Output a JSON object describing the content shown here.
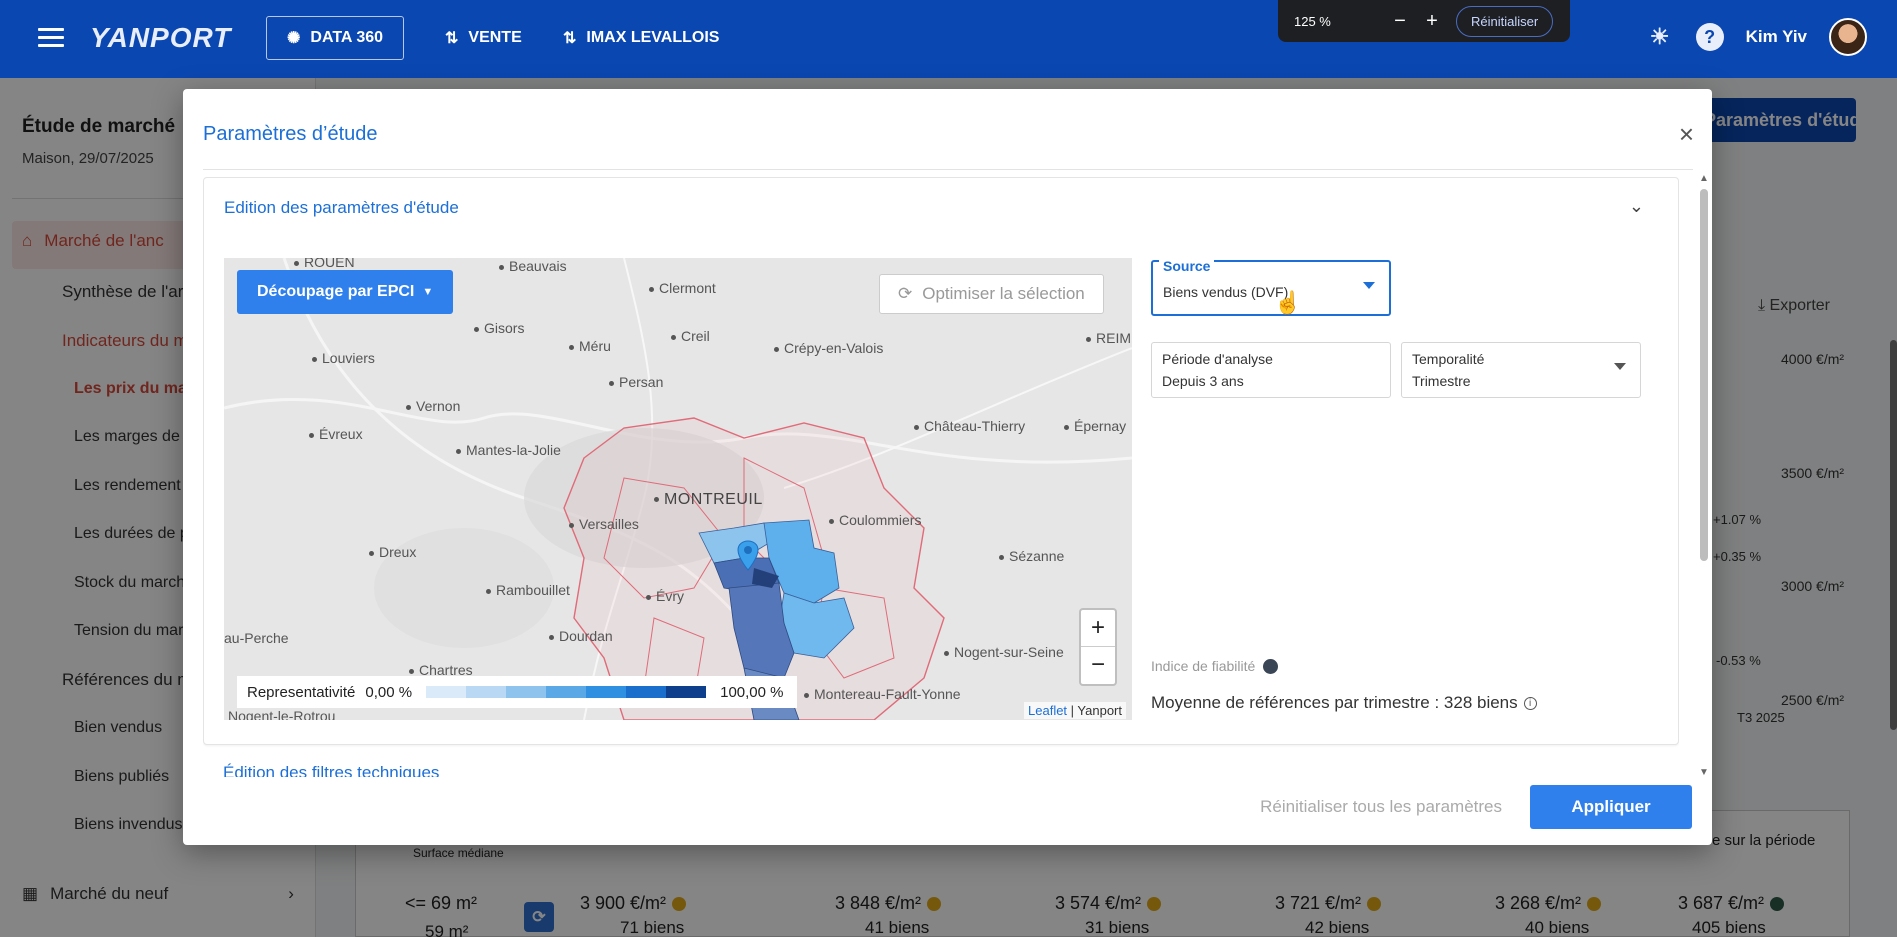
{
  "topbar": {
    "logo": "YANPORT",
    "nav": [
      {
        "label": "DATA 360"
      },
      {
        "label": "VENTE"
      },
      {
        "label": "IMAX LEVALLOIS"
      }
    ],
    "zoom": {
      "level": "125 %",
      "minus": "−",
      "plus": "+",
      "reset": "Réinitialiser"
    },
    "help": "?",
    "user_name": "Kim Yiv"
  },
  "sidebar": {
    "title": "Étude de marché",
    "subtitle": "Maison, 29/07/2025",
    "items": [
      {
        "label": "Marché de l'anc"
      },
      {
        "label": "Synthèse de l'ar"
      },
      {
        "label": "Indicateurs du m"
      },
      {
        "label": "Les prix du mar"
      },
      {
        "label": "Les marges de"
      },
      {
        "label": "Les rendement"
      },
      {
        "label": "Les durées de p"
      },
      {
        "label": "Stock du march"
      },
      {
        "label": "Tension du mar"
      },
      {
        "label": "Références du m"
      },
      {
        "label": "Bien vendus"
      },
      {
        "label": "Biens publiés"
      },
      {
        "label": "Biens invendus"
      },
      {
        "label": "Marché du neuf"
      }
    ]
  },
  "background": {
    "primary_button": "Paramètres d'étude",
    "export": "Exporter",
    "y_axis": [
      "4000 €/m²",
      "3500 €/m²",
      "3000 €/m²",
      "2500 €/m²"
    ],
    "pct_labels": [
      "+1.07 %",
      "+0.35 %",
      "-0.53 %"
    ],
    "x_label": "T3 2025",
    "table": {
      "col_surface": "Surface médiane",
      "col_periode": "e sur la période",
      "surface_value": "<= 69 m²",
      "surface_sub": "59 m²",
      "cells": [
        {
          "price": "3 900 €/m²",
          "count": "71 biens"
        },
        {
          "price": "3 848 €/m²",
          "count": "41 biens"
        },
        {
          "price": "3 574 €/m²",
          "count": "31 biens"
        },
        {
          "price": "3 721 €/m²",
          "count": "42 biens"
        },
        {
          "price": "3 268 €/m²",
          "count": "40 biens"
        },
        {
          "price": "3 687 €/m²",
          "count": "405 biens"
        }
      ]
    }
  },
  "modal": {
    "title": "Paramètres d’étude",
    "close": "×",
    "section_title": "Edition des paramètres d'étude",
    "next_section": "Édition des filtres techniques",
    "map": {
      "decoupage": "Découpage par EPCI",
      "optimiser": "Optimiser la sélection",
      "zoom_in": "+",
      "zoom_out": "−",
      "legend_label": "Representativité",
      "legend_min": "0,00 %",
      "legend_max": "100,00 %",
      "legend_colors": [
        "#dbeaf9",
        "#b9d8f3",
        "#8ec3ee",
        "#5aa8e6",
        "#2f8fe0",
        "#1a6fcc",
        "#0d3f8c"
      ],
      "attribution_link": "Leaflet",
      "attribution_text": " | Yanport",
      "cities": [
        "ROUEN",
        "Beauvais",
        "Clermont",
        "Gisors",
        "Creil",
        "Méru",
        "Crépy-en-Valois",
        "REIM",
        "Louviers",
        "Persan",
        "Vernon",
        "Évreux",
        "Mantes-la-Jolie",
        "Château-Thierry",
        "Épernay",
        "MONTREUIL",
        "Versailles",
        "Coulommiers",
        "Dreux",
        "Sézanne",
        "Rambouillet",
        "Évry",
        "Dourdan",
        "au-Perche",
        "Nogent-sur-Seine",
        "Chartres",
        "Montereau-Fault-Yonne",
        "Nogent-le-Rotrou"
      ]
    },
    "form": {
      "source_label": "Source",
      "source_value": "Biens vendus (DVF)",
      "periode_label": "Période d'analyse",
      "periode_value": "Depuis 3 ans",
      "temporalite_label": "Temporalité",
      "temporalite_value": "Trimestre",
      "fiabilite": "Indice de fiabilité",
      "moyenne": "Moyenne de références par trimestre : 328 biens"
    },
    "footer": {
      "reset_all": "Réinitialiser tous les paramètres",
      "apply": "Appliquer"
    }
  }
}
